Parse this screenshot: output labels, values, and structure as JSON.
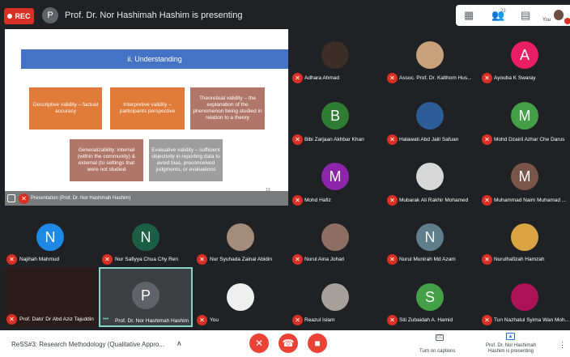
{
  "topbar": {
    "rec_label": "REC",
    "presenter_initial": "P",
    "presenting_title": "Prof. Dr. Nor Hashimah Hashim is presenting",
    "participant_count": "22",
    "you_label": "You"
  },
  "slide": {
    "banner": "ii. Understanding",
    "boxes": [
      "Descriptive validity – factual accuracy",
      "Interpretive validity – participants perspective",
      "Theoretical validity – the explanation of the phenomenon being studied in relation to a theory",
      "Generalizability: internal (within the community) & external (to settings that were not studied",
      "Evaluative validity – sufficient objectivity in reporting data to avoid bias, preconceived judgments, or evaluations"
    ],
    "slide_number": "13",
    "stage_label": "Presentation (Prof. Dr. Nor Hashimah Hashim)"
  },
  "participants": {
    "right": [
      {
        "name": "Adhara Ahmad",
        "initial": "",
        "color": ""
      },
      {
        "name": "Assoc. Prof. Dr. Kalthom Hus...",
        "initial": "",
        "color": ""
      },
      {
        "name": "Ayouba K Swaray",
        "initial": "A",
        "color": "#e91e63"
      },
      {
        "name": "Bibi Zarjaan Akhbar Khan",
        "initial": "B",
        "color": "#2e7d32"
      },
      {
        "name": "Halawati Abd Jalil Safuan",
        "initial": "",
        "color": ""
      },
      {
        "name": "Mohd Dzairil Azhar Che Darus",
        "initial": "M",
        "color": "#43a047"
      },
      {
        "name": "Mohd Hafiz",
        "initial": "M",
        "color": "#8e24aa"
      },
      {
        "name": "Mubarak Ali Rakhir Mohamed",
        "initial": "",
        "color": ""
      },
      {
        "name": "Muhammad Naim Muhamad ...",
        "initial": "M",
        "color": "#795548"
      }
    ],
    "row4": [
      {
        "name": "Najihah Mahmud",
        "initial": "N",
        "color": "#1e88e5"
      },
      {
        "name": "Nur Safiyya Chua Chy Ren",
        "initial": "N",
        "color": "#1b5e45"
      },
      {
        "name": "Nur Syuhada Zainal Abidin",
        "initial": "",
        "color": ""
      },
      {
        "name": "Nurul Aina Johari",
        "initial": "",
        "color": ""
      },
      {
        "name": "Nurul Munirah Md Azam",
        "initial": "N",
        "color": "#607d8b"
      },
      {
        "name": "Nurulhafizah Hamzah",
        "initial": "",
        "color": ""
      }
    ],
    "row5": [
      {
        "name": "Prof. Dato' Dr Abd Aziz Tajuddin",
        "initial": "",
        "color": ""
      },
      {
        "name": "Prof. Dr. Nor Hashimah Hashim",
        "initial": "P",
        "color": "#5f6368"
      },
      {
        "name": "You",
        "initial": "",
        "color": ""
      },
      {
        "name": "Reazul Islam",
        "initial": "",
        "color": ""
      },
      {
        "name": "Siti Zubaidah A. Hamid",
        "initial": "S",
        "color": "#43a047"
      },
      {
        "name": "Tun Nazhatul Syima Wan Moh...",
        "initial": "",
        "color": ""
      }
    ]
  },
  "bottombar": {
    "meeting_title": "ReSS#3: Research Methodology (Qualitative Appro...",
    "captions_label": "Turn on captions",
    "captions_icon": "CC",
    "presenting_label": "Prof. Dr. Nor Hashimah Hashim is presenting"
  },
  "colors": {
    "mic_off": "#d93025",
    "end_call": "#ea4335",
    "accent": "#86d5c8"
  }
}
